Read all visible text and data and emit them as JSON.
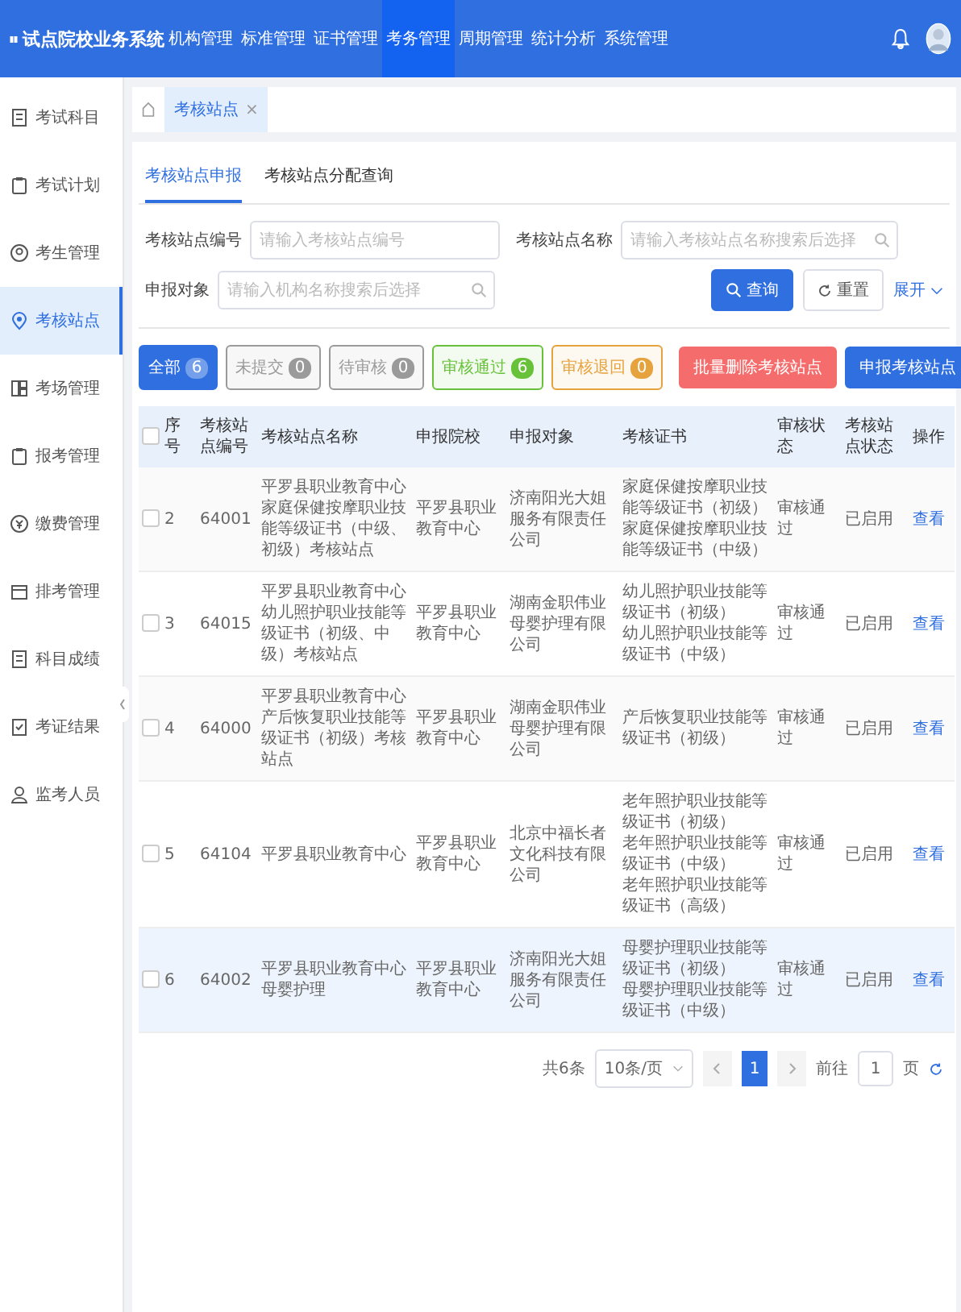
{
  "app": {
    "title": "试点院校业务系统"
  },
  "nav": [
    {
      "label": "机构管理",
      "selected": false
    },
    {
      "label": "标准管理",
      "selected": false
    },
    {
      "label": "证书管理",
      "selected": false
    },
    {
      "label": "考务管理",
      "selected": true
    },
    {
      "label": "周期管理",
      "selected": false
    },
    {
      "label": "统计分析",
      "selected": false
    },
    {
      "label": "系统管理",
      "selected": false
    }
  ],
  "sidebar": {
    "items": [
      {
        "label": "考试科目",
        "selected": false
      },
      {
        "label": "考试计划",
        "selected": false
      },
      {
        "label": "考生管理",
        "selected": false
      },
      {
        "label": "考核站点",
        "selected": true
      },
      {
        "label": "考场管理",
        "selected": false
      },
      {
        "label": "报考管理",
        "selected": false
      },
      {
        "label": "缴费管理",
        "selected": false
      },
      {
        "label": "排考管理",
        "selected": false
      },
      {
        "label": "科目成绩",
        "selected": false
      },
      {
        "label": "考证结果",
        "selected": false
      },
      {
        "label": "监考人员",
        "selected": false
      }
    ]
  },
  "breadcrumb": {
    "tabs": [
      {
        "label": "考核站点",
        "close": "×",
        "selected": true
      }
    ]
  },
  "tabs": [
    {
      "label": "考核站点申报",
      "selected": true
    },
    {
      "label": "考核站点分配查询",
      "selected": false
    }
  ],
  "filters": [
    {
      "label": "考核站点编号",
      "placeholder": "请输入考核站点编号",
      "kind": "text"
    },
    {
      "label": "考核站点名称",
      "placeholder": "请输入考核站点名称搜索后选择",
      "kind": "search"
    },
    {
      "label": "申报对象",
      "placeholder": "请输入机构名称搜索后选择",
      "kind": "search"
    }
  ],
  "actions": {
    "search": "查询",
    "reset": "重置",
    "expand": "展开"
  },
  "chips": [
    {
      "label": "全部",
      "count": "6",
      "selected": true,
      "color": "#2f6fe0"
    },
    {
      "label": "未提交",
      "count": "0",
      "selected": false,
      "color": "#9a9a9a"
    },
    {
      "label": "待审核",
      "count": "0",
      "selected": false,
      "color": "#9a9a9a"
    },
    {
      "label": "审核通过",
      "count": "6",
      "selected": false,
      "color": "#67c23a"
    },
    {
      "label": "审核退回",
      "count": "0",
      "selected": false,
      "color": "#e6a23c"
    }
  ],
  "buttons": {
    "batch_delete": "批量删除考核站点",
    "declare": "申报考核站点"
  },
  "table": {
    "select_all": {
      "checked": false
    },
    "columns": [
      "序号",
      "考核站点编号",
      "考核站点名称",
      "申报院校",
      "申报对象",
      "考核证书",
      "审核状态",
      "考核站点状态",
      "操作"
    ],
    "rows": [
      {
        "checked": false,
        "highlighted": false,
        "index": "2",
        "code": "64001",
        "name": "平罗县职业教育中心家庭保健按摩职业技能等级证书（中级、初级）考核站点",
        "school": "平罗县职业教育中心",
        "target": "济南阳光大姐服务有限责任公司",
        "certificates": [
          "家庭保健按摩职业技能等级证书（初级）",
          "家庭保健按摩职业技能等级证书（中级）"
        ],
        "review_status": "审核通过",
        "site_status": "已启用",
        "action": "查看"
      },
      {
        "checked": false,
        "highlighted": false,
        "index": "3",
        "code": "64015",
        "name": "平罗县职业教育中心幼儿照护职业技能等级证书（初级、中级）考核站点",
        "school": "平罗县职业教育中心",
        "target": "湖南金职伟业母婴护理有限公司",
        "certificates": [
          "幼儿照护职业技能等级证书（初级）",
          "幼儿照护职业技能等级证书（中级）"
        ],
        "review_status": "审核通过",
        "site_status": "已启用",
        "action": "查看"
      },
      {
        "checked": false,
        "highlighted": false,
        "index": "4",
        "code": "64000",
        "name": "平罗县职业教育中心产后恢复职业技能等级证书（初级）考核站点",
        "school": "平罗县职业教育中心",
        "target": "湖南金职伟业母婴护理有限公司",
        "certificates": [
          "产后恢复职业技能等级证书（初级）"
        ],
        "review_status": "审核通过",
        "site_status": "已启用",
        "action": "查看"
      },
      {
        "checked": false,
        "highlighted": false,
        "index": "5",
        "code": "64104",
        "name": "平罗县职业教育中心",
        "school": "平罗县职业教育中心",
        "target": "北京中福长者文化科技有限公司",
        "certificates": [
          "老年照护职业技能等级证书（初级）",
          "老年照护职业技能等级证书（中级）",
          "老年照护职业技能等级证书（高级）"
        ],
        "review_status": "审核通过",
        "site_status": "已启用",
        "action": "查看"
      },
      {
        "checked": false,
        "highlighted": true,
        "index": "6",
        "code": "64002",
        "name": "平罗县职业教育中心母婴护理",
        "school": "平罗县职业教育中心",
        "target": "济南阳光大姐服务有限责任公司",
        "certificates": [
          "母婴护理职业技能等级证书（初级）",
          "母婴护理职业技能等级证书（中级）"
        ],
        "review_status": "审核通过",
        "site_status": "已启用",
        "action": "查看"
      }
    ]
  },
  "pagination": {
    "total": "共6条",
    "page_size": "10条/页",
    "pages": [
      {
        "label": "1",
        "selected": true
      }
    ],
    "goto_label": "前往",
    "goto_value": "1",
    "goto_suffix": "页"
  }
}
